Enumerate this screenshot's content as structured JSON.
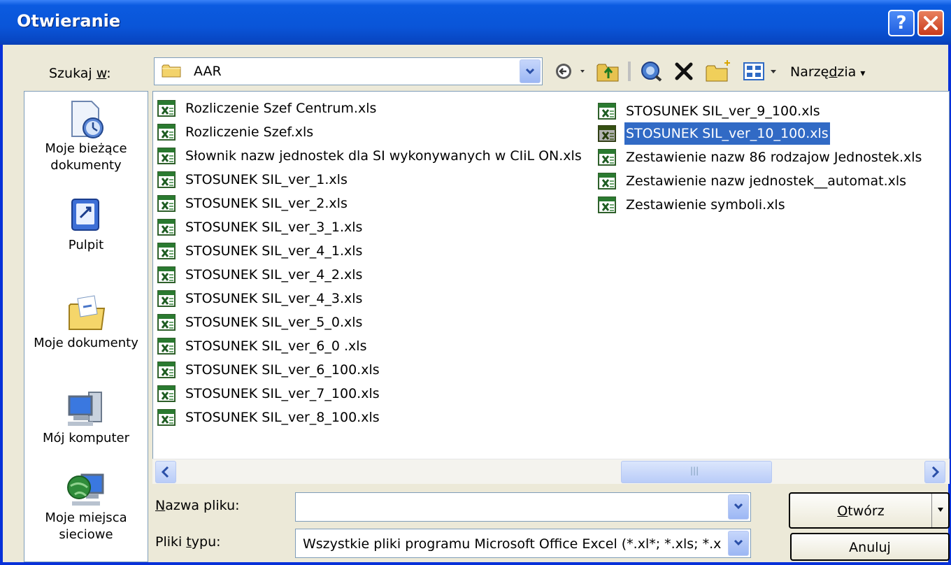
{
  "window": {
    "title": "Otwieranie"
  },
  "lookin": {
    "label_prefix": "Szukaj ",
    "label_accel": "w",
    "label_suffix": ":",
    "value": "AAR"
  },
  "toolbar": {
    "tools_label_prefix": "Narzę",
    "tools_label_accel": "d",
    "tools_label_suffix": "zia"
  },
  "places": [
    {
      "label1": "Moje bieżące",
      "label2": "dokumenty",
      "icon": "recent-documents-icon"
    },
    {
      "label1": "Pulpit",
      "label2": "",
      "icon": "desktop-icon"
    },
    {
      "label1": "Moje dokumenty",
      "label2": "",
      "icon": "my-documents-icon"
    },
    {
      "label1": "Mój komputer",
      "label2": "",
      "icon": "my-computer-icon"
    },
    {
      "label1": "Moje miejsca",
      "label2": "sieciowe",
      "icon": "network-places-icon"
    }
  ],
  "files": {
    "column1": [
      "Rozliczenie Szef Centrum.xls",
      "Rozliczenie Szef.xls",
      "Słownik nazw jednostek dla SI wykonywanych w CIiL ON.xls",
      "STOSUNEK SIL_ver_1.xls",
      "STOSUNEK SIL_ver_2.xls",
      "STOSUNEK SIL_ver_3_1.xls",
      "STOSUNEK SIL_ver_4_1.xls",
      "STOSUNEK SIL_ver_4_2.xls",
      "STOSUNEK SIL_ver_4_3.xls",
      "STOSUNEK SIL_ver_5_0.xls",
      "STOSUNEK SIL_ver_6_0 .xls",
      "STOSUNEK SIL_ver_6_100.xls",
      "STOSUNEK SIL_ver_7_100.xls",
      "STOSUNEK SIL_ver_8_100.xls"
    ],
    "column2": [
      "STOSUNEK SIL_ver_9_100.xls",
      "STOSUNEK SIL_ver_10_100.xls",
      "Zestawienie nazw 86 rodzajow Jednostek.xls",
      "Zestawienie nazw jednostek__automat.xls",
      "Zestawienie symboli.xls"
    ],
    "selected": "STOSUNEK SIL_ver_10_100.xls"
  },
  "filename": {
    "label_accel": "N",
    "label_rest": "azwa pliku:",
    "value": ""
  },
  "filetype": {
    "label_prefix": "Pliki ",
    "label_accel": "t",
    "label_suffix": "ypu:",
    "value": "Wszystkie pliki programu Microsoft Office Excel (*.xl*; *.xls; *.xlsx; *.xlsm; *.xlsb; *.xlam; *.xltx; *.xltm; *.xla; *.xlt; *.xlm; *.xlw)"
  },
  "buttons": {
    "open_accel": "O",
    "open_rest": "twórz",
    "cancel": "Anuluj"
  },
  "colors": {
    "titlebar": "#0a55d8",
    "selection": "#316ac5",
    "dialog_bg": "#ece9d8"
  }
}
